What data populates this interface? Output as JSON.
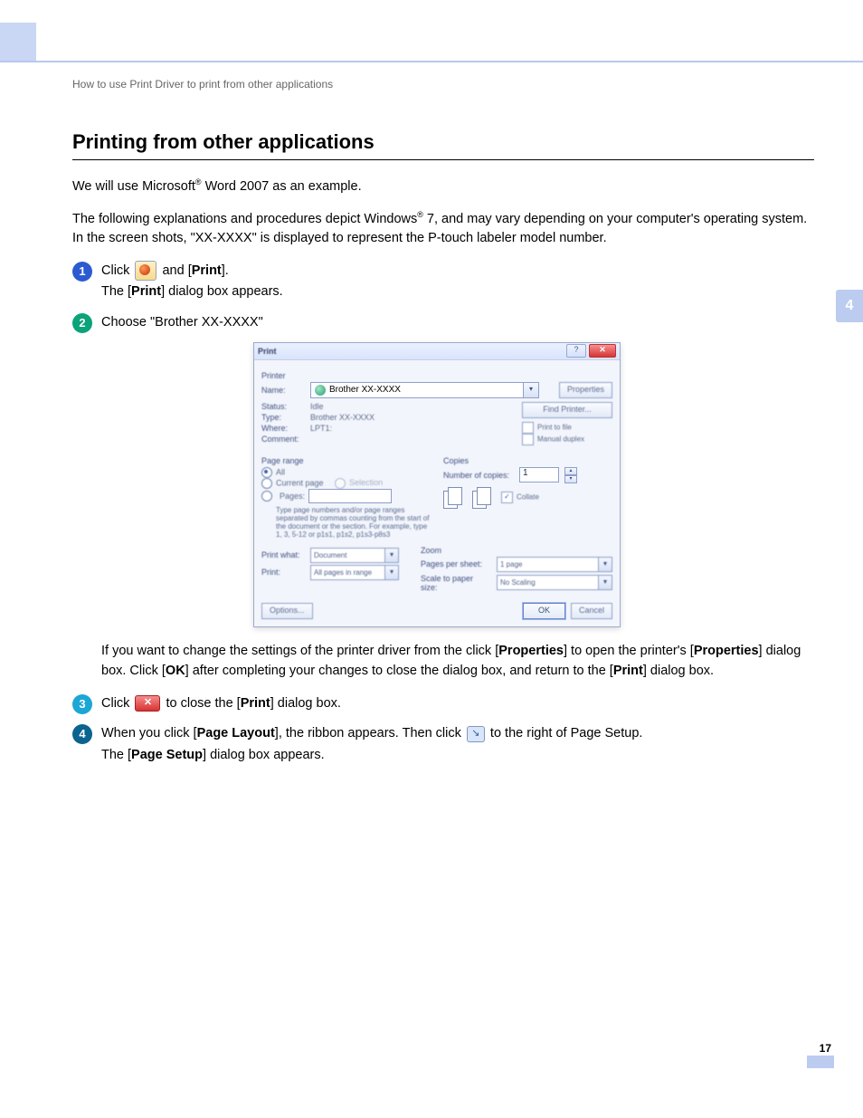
{
  "breadcrumb": "How to use Print Driver to print from other applications",
  "side_tab": "4",
  "page_number": "17",
  "title": "Printing from other applications",
  "intro1_pre": "We will use Microsoft",
  "intro1_post": " Word 2007 as an example.",
  "intro2_pre": "The following explanations and procedures depict Windows",
  "intro2_post": " 7, and may vary depending on your computer's operating system. In the screen shots, \"XX-XXXX\" is displayed to represent the P-touch labeler model number.",
  "step1_a": "Click ",
  "step1_b": " and [",
  "step1_print": "Print",
  "step1_c": "].",
  "step1_sub_a": "The [",
  "step1_sub_b": "Print",
  "step1_sub_c": "] dialog box appears.",
  "step2": "Choose \"Brother XX-XXXX\"",
  "step2_note_a": "If you want to change the settings of the printer driver from the click [",
  "step2_note_b": "Properties",
  "step2_note_c": "] to open the printer's [",
  "step2_note_d": "Properties",
  "step2_note_e": "] dialog box. Click [",
  "step2_note_f": "OK",
  "step2_note_g": "] after completing your changes to close the dialog box, and return to the [",
  "step2_note_h": "Print",
  "step2_note_i": "] dialog box.",
  "step3_a": "Click ",
  "step3_b": " to close the [",
  "step3_c": "Print",
  "step3_d": "] dialog box.",
  "step4_a": "When you click [",
  "step4_b": "Page Layout",
  "step4_c": "], the ribbon appears. Then click ",
  "step4_d": " to the right of Page Setup.",
  "step4_sub_a": "The [",
  "step4_sub_b": "Page Setup",
  "step4_sub_c": "] dialog box appears.",
  "dialog": {
    "title": "Print",
    "printer_section": "Printer",
    "name_label": "Name:",
    "printer_name": "Brother XX-XXXX",
    "status_label": "Status:",
    "status_value": "Idle",
    "type_label": "Type:",
    "type_value": "Brother XX-XXXX",
    "where_label": "Where:",
    "where_value": "LPT1:",
    "comment_label": "Comment:",
    "properties_btn": "Properties",
    "find_printer_btn": "Find Printer...",
    "print_to_file": "Print to file",
    "manual_duplex": "Manual duplex",
    "page_range_section": "Page range",
    "range_all": "All",
    "range_current": "Current page",
    "range_selection": "Selection",
    "range_pages": "Pages:",
    "range_help": "Type page numbers and/or page ranges separated by commas counting from the start of the document or the section. For example, type 1, 3, 5-12 or p1s1, p1s2, p1s3-p8s3",
    "copies_section": "Copies",
    "copies_label": "Number of copies:",
    "copies_value": "1",
    "collate": "Collate",
    "print_what_label": "Print what:",
    "print_what_value": "Document",
    "print_label": "Print:",
    "print_value": "All pages in range",
    "zoom_section": "Zoom",
    "pages_per_sheet_label": "Pages per sheet:",
    "pages_per_sheet_value": "1 page",
    "scale_label": "Scale to paper size:",
    "scale_value": "No Scaling",
    "options_btn": "Options...",
    "ok_btn": "OK",
    "cancel_btn": "Cancel"
  }
}
